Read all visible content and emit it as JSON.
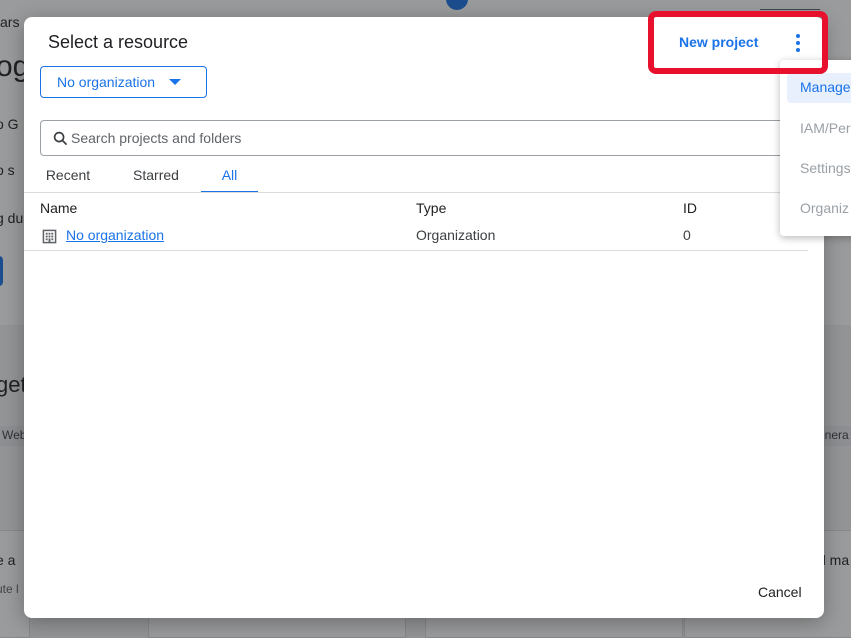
{
  "background": {
    "fragments": [
      "ars",
      "og",
      "o G",
      "o s",
      "g du",
      "get",
      "Web,",
      "enera",
      "e a",
      "ute l",
      "d ma"
    ]
  },
  "dialog": {
    "title": "Select a resource",
    "new_project_label": "New project",
    "more_icon": "more-vert-icon",
    "org_selector": {
      "value": "No organization"
    },
    "search": {
      "placeholder": "Search projects and folders",
      "value": ""
    },
    "tabs": [
      {
        "label": "Recent",
        "active": false
      },
      {
        "label": "Starred",
        "active": false
      },
      {
        "label": "All",
        "active": true
      }
    ],
    "table": {
      "headers": {
        "name": "Name",
        "type": "Type",
        "id": "ID"
      },
      "rows": [
        {
          "icon": "building-icon",
          "name": "No organization",
          "type": "Organization",
          "id": "0"
        }
      ]
    },
    "cancel_label": "Cancel"
  },
  "menu": {
    "items": [
      {
        "label": "Manage",
        "state": "active"
      },
      {
        "label": "IAM/Per",
        "state": "disabled"
      },
      {
        "label": "Settings",
        "state": "disabled"
      },
      {
        "label": "Organiz",
        "state": "disabled"
      }
    ]
  },
  "colors": {
    "accent": "#1a73e8",
    "annotation": "#e8112d",
    "disabled": "#9aa0a6"
  }
}
